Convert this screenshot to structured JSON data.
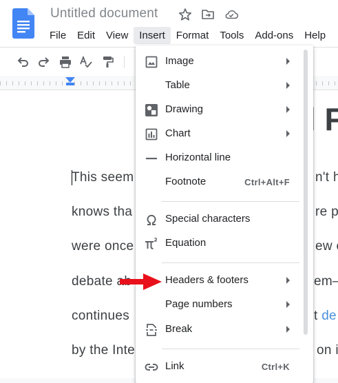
{
  "app": {
    "doc_title": "Untitled document"
  },
  "menubar": [
    "File",
    "Edit",
    "View",
    "Insert",
    "Format",
    "Tools",
    "Add-ons",
    "Help"
  ],
  "document": {
    "heading_right": "l F",
    "lines": [
      {
        "left": "This seem",
        "right": "n't h"
      },
      {
        "left": "knows tha",
        "right": "re pl"
      },
      {
        "left": "were once",
        "right": "ew c"
      },
      {
        "left": "debate ab",
        "right": "em–"
      },
      {
        "left": "continues",
        "right": "t",
        "link": "de"
      },
      {
        "left": "by the Inte",
        "right": "on i"
      }
    ]
  },
  "insert_menu": {
    "items": [
      {
        "label": "Image",
        "icon": "image-icon",
        "submenu": true
      },
      {
        "label": "Table",
        "icon": "",
        "submenu": true
      },
      {
        "label": "Drawing",
        "icon": "drawing-icon",
        "submenu": true
      },
      {
        "label": "Chart",
        "icon": "chart-icon",
        "submenu": true
      },
      {
        "label": "Horizontal line",
        "icon": "horizontal-line-icon",
        "submenu": false
      },
      {
        "label": "Footnote",
        "icon": "",
        "shortcut": "Ctrl+Alt+F"
      },
      {
        "label": "Special characters",
        "icon": "omega-icon",
        "submenu": false
      },
      {
        "label": "Equation",
        "icon": "pi-icon",
        "submenu": false
      },
      {
        "label": "Headers & footers",
        "icon": "",
        "submenu": true
      },
      {
        "label": "Page numbers",
        "icon": "",
        "submenu": true
      },
      {
        "label": "Break",
        "icon": "break-icon",
        "submenu": true
      },
      {
        "label": "Link",
        "icon": "link-icon",
        "shortcut": "Ctrl+K"
      }
    ]
  },
  "colors": {
    "accent": "#4285f4",
    "menu_active_bg": "#e8eaed",
    "annotation_arrow": "#e8101a",
    "link": "#4a90d9"
  }
}
